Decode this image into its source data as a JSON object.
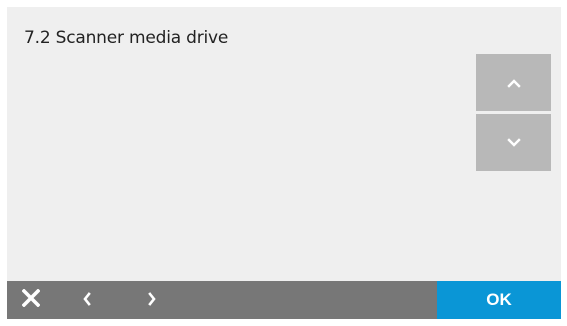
{
  "screen": {
    "title": "7.2 Scanner media drive"
  },
  "scroll": {
    "up_icon": "chevron-up-icon",
    "down_icon": "chevron-down-icon"
  },
  "bottom_bar": {
    "close_icon": "close-icon",
    "back_icon": "chevron-left-icon",
    "forward_icon": "chevron-right-icon",
    "ok_label": "OK"
  },
  "colors": {
    "background": "#efefef",
    "scroll_button": "#b8b8b8",
    "bottom_bar": "#777777",
    "ok_button": "#0a96d6",
    "icon": "#ffffff"
  }
}
